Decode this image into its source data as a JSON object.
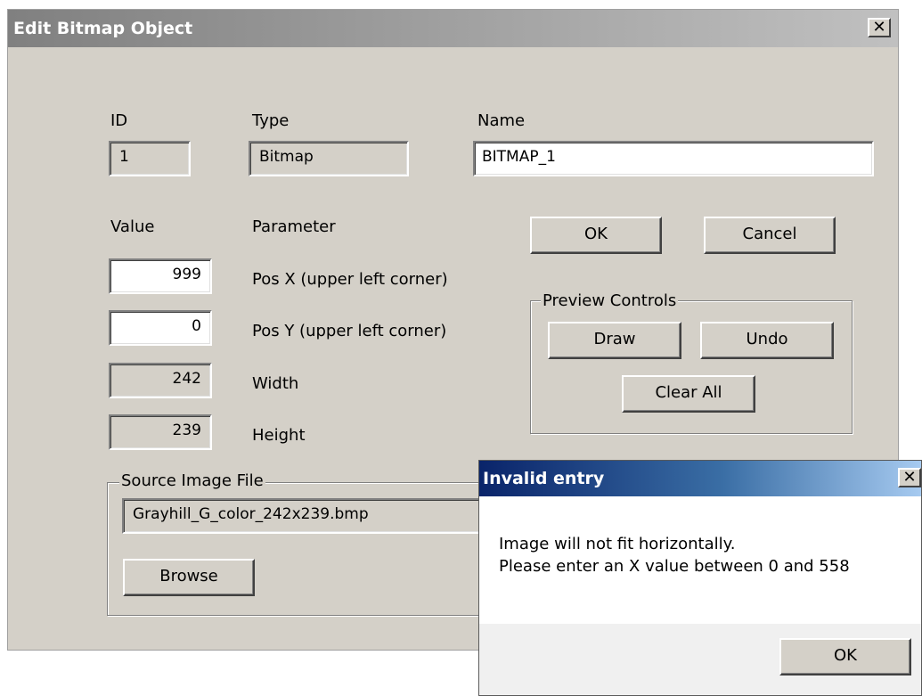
{
  "main_dialog": {
    "title": "Edit Bitmap Object",
    "close_glyph": "✕",
    "id_label": "ID",
    "id_value": "1",
    "type_label": "Type",
    "type_value": "Bitmap",
    "name_label": "Name",
    "name_value": "BITMAP_1",
    "value_header": "Value",
    "parameter_header": "Parameter",
    "params": [
      {
        "value": "999",
        "label": "Pos X (upper left corner)",
        "editable": true
      },
      {
        "value": "0",
        "label": "Pos Y (upper left corner)",
        "editable": true
      },
      {
        "value": "242",
        "label": "Width",
        "editable": false
      },
      {
        "value": "239",
        "label": "Height",
        "editable": false
      }
    ],
    "ok_label": "OK",
    "cancel_label": "Cancel",
    "preview_controls": {
      "label": "Preview Controls",
      "draw_label": "Draw",
      "undo_label": "Undo",
      "clear_all_label": "Clear All"
    },
    "source_image": {
      "label": "Source Image File",
      "file_value": "Grayhill_G_color_242x239.bmp",
      "browse_label": "Browse"
    }
  },
  "popup": {
    "title": "Invalid entry",
    "close_glyph": "✕",
    "message_line1": "Image will not fit horizontally.",
    "message_line2": "Please enter an X value between 0 and 558",
    "ok_label": "OK"
  },
  "colors": {
    "dialog_face": "#d4d0c8",
    "main_title_gradient_start": "#808080",
    "popup_title_gradient_start": "#0a246a",
    "popup_title_gradient_end": "#a6caf0"
  }
}
